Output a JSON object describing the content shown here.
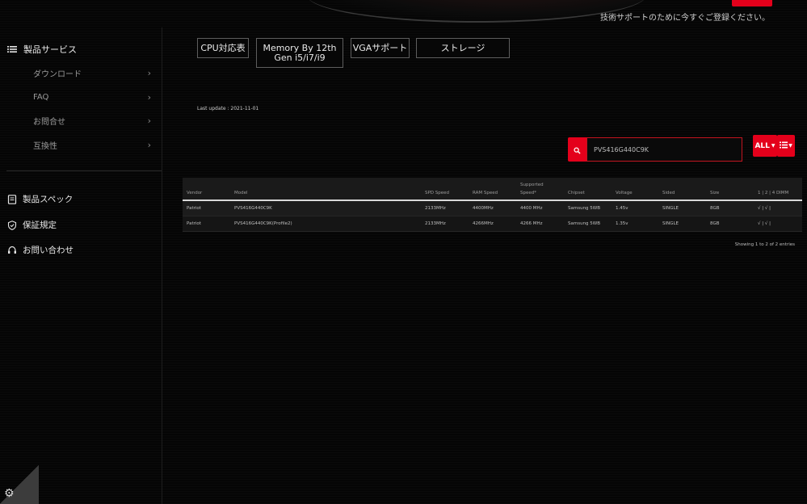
{
  "header": {
    "register_text": "技術サポートのために今すぐご登録ください。"
  },
  "sidebar": {
    "section_title": "製品サービス",
    "sub_items": [
      {
        "label": "ダウンロード"
      },
      {
        "label": "FAQ"
      },
      {
        "label": "お問合せ"
      },
      {
        "label": "互換性"
      }
    ],
    "links": [
      {
        "label": "製品スペック",
        "icon": "document-icon"
      },
      {
        "label": "保証規定",
        "icon": "shield-icon"
      },
      {
        "label": "お問い合わせ",
        "icon": "headset-icon"
      }
    ],
    "settings_icon": "gear-icon"
  },
  "tabs": {
    "cpu": "CPU対応表",
    "memory_line1": "Memory By 12th",
    "memory_line2": "Gen i5/i7/i9",
    "vga": "VGAサポート",
    "storage": "ストレージ"
  },
  "last_update": "Last update : 2021-11-01",
  "search": {
    "value": "PVS416G440C9K"
  },
  "filters": {
    "all_label": "ALL",
    "columns_icon": "list-icon"
  },
  "table": {
    "headers": {
      "vendor": "Vendor",
      "model": "Model",
      "spd": "SPD Speed",
      "ram": "RAM Speed",
      "supported1": "Supported",
      "supported2": "Speed*",
      "chipset": "Chipset",
      "voltage": "Voltage",
      "sided": "Sided",
      "size": "Size",
      "dimm": "1 | 2 | 4 DIMM"
    },
    "rows": [
      {
        "vendor": "Patriot",
        "model": "PVS416G440C9K",
        "spd": "2133MHz",
        "ram": "4400MHz",
        "supported": "4400 MHz",
        "chipset": "Samsung 5WB",
        "voltage": "1.45v",
        "sided": "SINGLE",
        "size": "8GB",
        "dimm": "√ | √ |"
      },
      {
        "vendor": "Patriot",
        "model": "PVS416G440C9K(Profile2)",
        "spd": "2133MHz",
        "ram": "4266MHz",
        "supported": "4266 MHz",
        "chipset": "Samsung 5WB",
        "voltage": "1.35v",
        "sided": "SINGLE",
        "size": "8GB",
        "dimm": "√ | √ |"
      }
    ]
  },
  "showing": "Showing 1 to 2 of 2 entries",
  "colors": {
    "accent": "#e4001b",
    "background": "#050505"
  }
}
